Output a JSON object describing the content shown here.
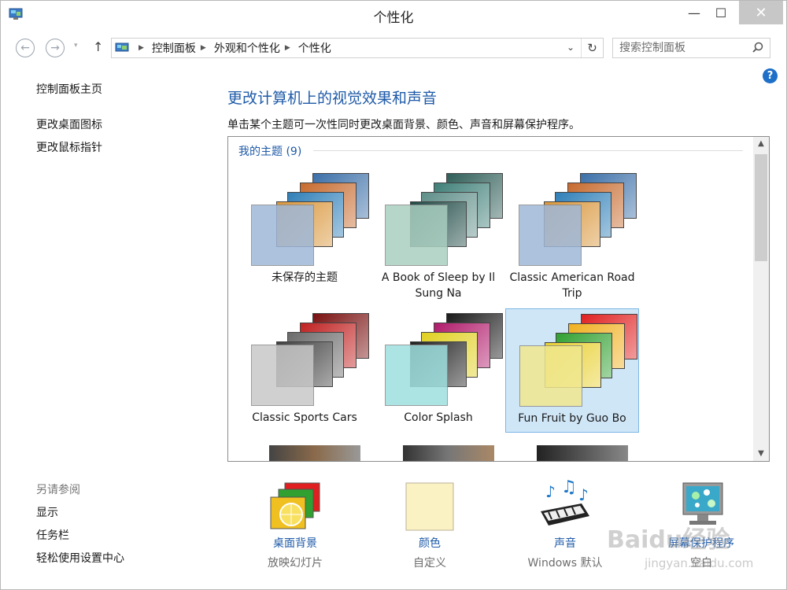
{
  "window": {
    "title": "个性化",
    "min_glyph": "—",
    "max_glyph": "☐",
    "close_glyph": "✕"
  },
  "nav": {
    "back_glyph": "←",
    "forward_glyph": "→",
    "drop_glyph": "▾",
    "up_glyph": "↑",
    "breadcrumb": [
      "控制面板",
      "外观和个性化",
      "个性化"
    ],
    "crumb_sep": "▶",
    "addr_drop_glyph": "⌄",
    "refresh_glyph": "↻",
    "search_placeholder": "搜索控制面板",
    "search_glyph": "⚲"
  },
  "help_glyph": "?",
  "sidebar": {
    "home": "控制面板主页",
    "links": [
      "更改桌面图标",
      "更改鼠标指针"
    ],
    "see_also_title": "另请参阅",
    "see_also": [
      "显示",
      "任务栏",
      "轻松使用设置中心"
    ]
  },
  "main": {
    "heading": "更改计算机上的视觉效果和声音",
    "subtext": "单击某个主题可一次性同时更改桌面背景、颜色、声音和屏幕保护程序。",
    "group_title": "我的主题 (9)",
    "themes": [
      {
        "name": "未保存的主题",
        "selected": false,
        "front": "#9fb8d8",
        "cards": [
          "#3b6fa8",
          "#c76a2e",
          "#2f7fb8",
          "#d9963b"
        ]
      },
      {
        "name": "A Book of Sleep by Il Sung Na",
        "selected": false,
        "front": "#a9cfc0",
        "cards": [
          "#2f5e58",
          "#3f7f78",
          "#5e8e88",
          "#1f4a46"
        ]
      },
      {
        "name": "Classic American Road Trip",
        "selected": false,
        "front": "#9fb8d8",
        "cards": [
          "#3b6fa8",
          "#c76a2e",
          "#2f7fb8",
          "#d9963b"
        ]
      },
      {
        "name": "Classic Sports Cars",
        "selected": false,
        "front": "#c8c8c8",
        "cards": [
          "#7a1010",
          "#c02020",
          "#6a6a6a",
          "#404040"
        ]
      },
      {
        "name": "Color Splash",
        "selected": false,
        "front": "#9ee0e0",
        "cards": [
          "#1a1a1a",
          "#b01a6a",
          "#e0d020",
          "#202020"
        ]
      },
      {
        "name": "Fun Fruit by Guo Bo",
        "selected": true,
        "front": "#f0e890",
        "cards": [
          "#e02020",
          "#f0b020",
          "#30a030",
          "#e8d030"
        ]
      }
    ],
    "scroll_up": "▲",
    "scroll_down": "▼"
  },
  "bottom": [
    {
      "name": "桌面背景",
      "value": "放映幻灯片",
      "icon": "desktop-background-icon"
    },
    {
      "name": "颜色",
      "value": "自定义",
      "icon": "color-swatch-icon"
    },
    {
      "name": "声音",
      "value": "Windows 默认",
      "icon": "sound-piano-icon"
    },
    {
      "name": "屏幕保护程序",
      "value": "空白",
      "icon": "screensaver-monitor-icon"
    }
  ],
  "watermark": "Baidu经验",
  "watermark_url": "jingyan.baidu.com"
}
